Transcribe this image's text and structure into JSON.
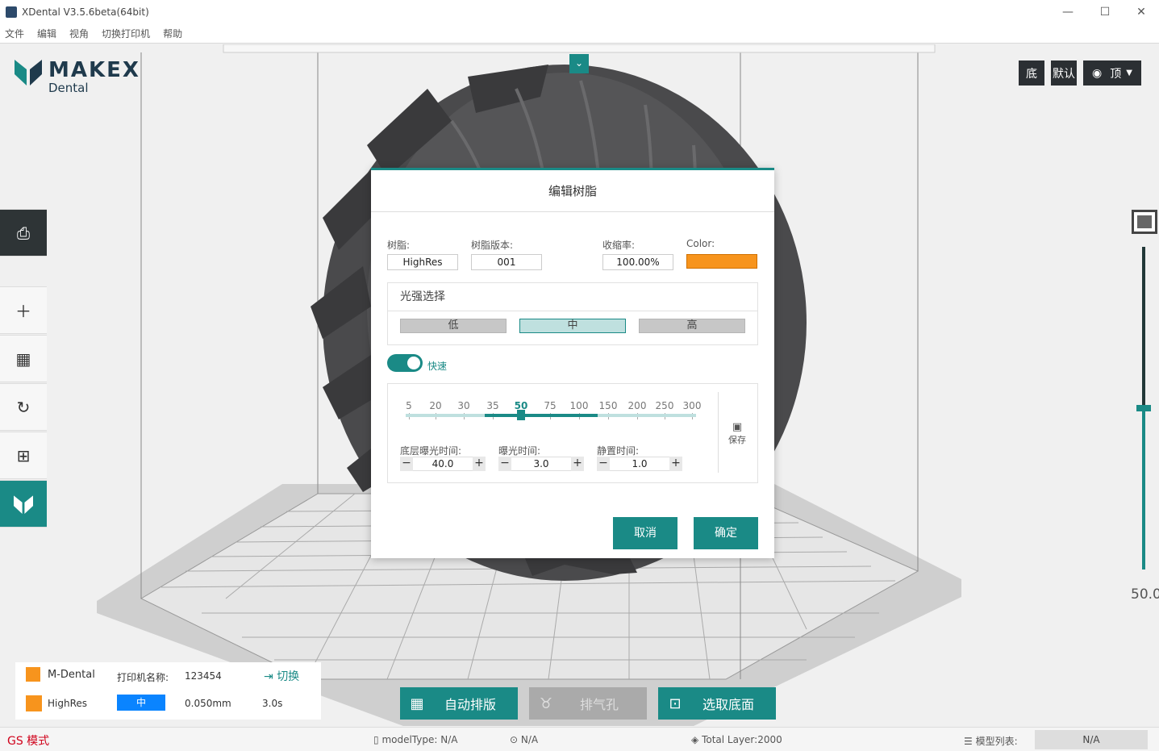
{
  "window": {
    "title": "XDental V3.5.6beta(64bit)",
    "minimize": "—",
    "maximize": "☐",
    "close": "✕"
  },
  "menu": [
    "文件",
    "编辑",
    "视角",
    "切换打印机",
    "帮助"
  ],
  "logo": {
    "brand": "MAKEX",
    "sub": "Dental"
  },
  "view_buttons": {
    "bottom": "底",
    "default": "默认",
    "top": "顶"
  },
  "layer_slider": {
    "value": "50.0"
  },
  "dialog": {
    "title": "编辑树脂",
    "resin_label": "树脂:",
    "resin_value": "HighRes",
    "version_label": "树脂版本:",
    "version_value": "001",
    "shrink_label": "收缩率:",
    "shrink_value": "100.00%",
    "color_label": "Color:",
    "color_value": "#f7941d",
    "light_header": "光强选择",
    "levels": [
      "低",
      "中",
      "高"
    ],
    "active_level": "中",
    "fast_label": "快速",
    "fast_on": true,
    "ticks": [
      "5",
      "20",
      "30",
      "35",
      "50",
      "75",
      "100",
      "150",
      "200",
      "250",
      "300"
    ],
    "selected_tick": "50",
    "bottom_exposure_label": "底层曝光时间:",
    "bottom_exposure_value": "40.0",
    "exposure_label": "曝光时间:",
    "exposure_value": "3.0",
    "rest_label": "静置时间:",
    "rest_value": "1.0",
    "save_label": "保存",
    "cancel": "取消",
    "ok": "确定"
  },
  "printer_info": {
    "printer": "M-Dental",
    "name_label": "打印机名称:",
    "name_value": "123454",
    "switch": "切换",
    "resin": "HighRes",
    "level": "中",
    "layer": "0.050mm",
    "time": "3.0s"
  },
  "actions": {
    "auto_layout": "自动排版",
    "vent": "排气孔",
    "select_bottom": "选取底面"
  },
  "status": {
    "mode": "GS 模式",
    "model_type": "modelType: N/A",
    "scan": "N/A",
    "total_layer": "Total Layer:2000",
    "model_list": "模型列表:",
    "model_list_value": "N/A"
  },
  "colors": {
    "accent": "#1a8a86",
    "resin": "#f7941d",
    "badge": "#0a84ff"
  }
}
